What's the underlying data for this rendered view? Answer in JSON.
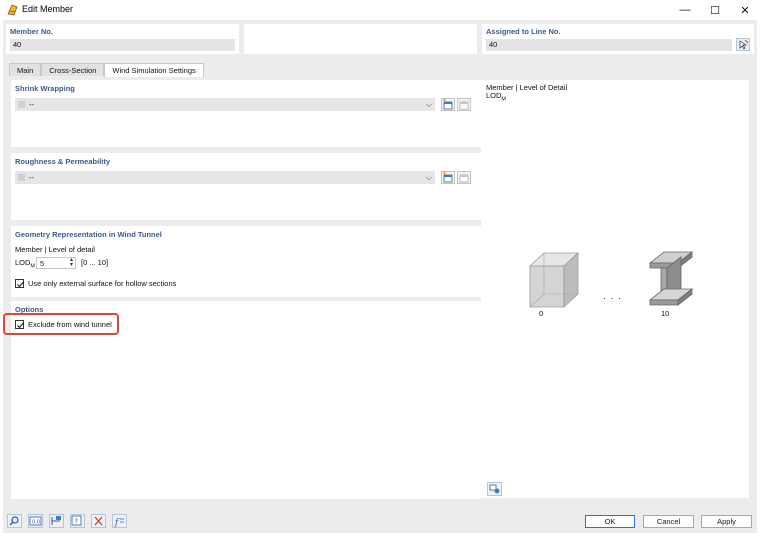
{
  "window": {
    "title": "Edit Member",
    "minimize": "—",
    "maximize": "☐",
    "close": "✕"
  },
  "header": {
    "member_no_label": "Member No.",
    "member_no_value": "40",
    "assigned_line_label": "Assigned to Line No.",
    "assigned_line_value": "40"
  },
  "tabs": [
    {
      "label": "Main",
      "active": false
    },
    {
      "label": "Cross-Section",
      "active": false
    },
    {
      "label": "Wind Simulation Settings",
      "active": true
    }
  ],
  "shrink_wrapping": {
    "title": "Shrink Wrapping",
    "value": "--"
  },
  "roughness": {
    "title": "Roughness & Permeability",
    "value": "--"
  },
  "geometry": {
    "title": "Geometry Representation in Wind Tunnel",
    "member_level_label": "Member | Level of detail",
    "lod_label": "LOD",
    "lod_sub": "M",
    "lod_value": "5",
    "lod_range": "[0 ... 10]",
    "external_surface_label": "Use only external surface for hollow sections",
    "external_surface_checked": true
  },
  "options": {
    "title": "Options",
    "exclude_label": "Exclude from wind tunnel",
    "exclude_checked": true
  },
  "preview": {
    "title": "Member | Level of Detail",
    "subtitle": "LOD",
    "subtitle_sub": "M",
    "left_caption": "0",
    "ellipsis": "· · ·",
    "right_caption": "10"
  },
  "buttons": {
    "ok": "OK",
    "cancel": "Cancel",
    "apply": "Apply"
  },
  "colors": {
    "section_title": "#3b5b8a",
    "highlight": "#e0463a",
    "primary_border": "#2f6fd6"
  }
}
